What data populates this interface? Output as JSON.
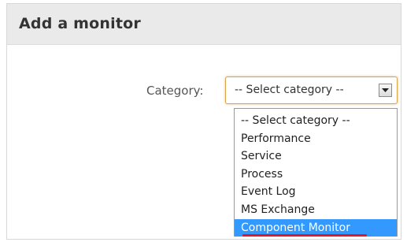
{
  "header": {
    "title": "Add a monitor"
  },
  "form": {
    "category_label": "Category:",
    "category_select": {
      "selected_value": "-- Select category --",
      "options": [
        "-- Select category --",
        "Performance",
        "Service",
        "Process",
        "Event Log",
        "MS Exchange",
        "Component Monitor"
      ],
      "highlighted_option": "Component Monitor"
    }
  },
  "colors": {
    "header_bg": "#eaeaea",
    "select_focus_border": "#d9a44a",
    "highlight_bg": "#3399ff",
    "annotation_underline": "#e0192a"
  },
  "icons": {
    "dropdown_arrow": "chevron-down-icon"
  }
}
